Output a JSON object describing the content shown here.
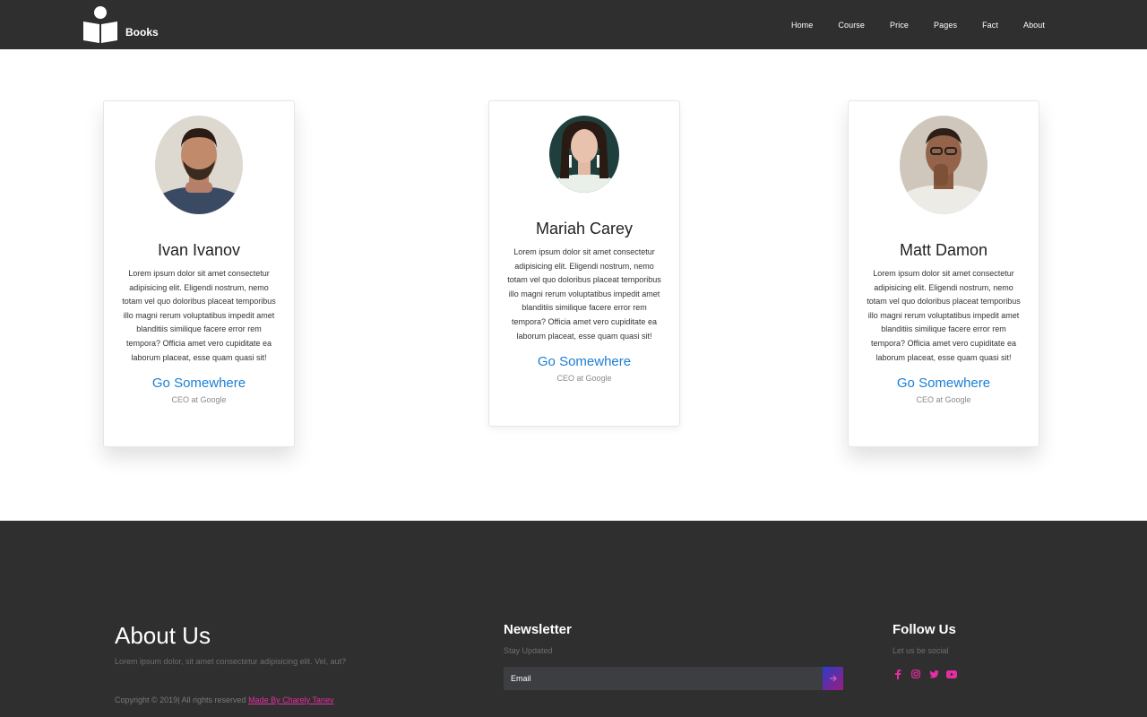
{
  "nav": {
    "brand": "Books",
    "links": [
      "Home",
      "Course",
      "Price",
      "Pages",
      "Fact",
      "About"
    ]
  },
  "cards": [
    {
      "name": "Ivan Ivanov",
      "text": "Lorem ipsum dolor sit amet consectetur adipisicing elit. Eligendi nostrum, nemo totam vel quo doloribus placeat temporibus illo magni rerum voluptatibus impedit amet blanditiis similique facere error rem tempora? Officia amet vero cupiditate ea laborum placeat, esse quam quasi sit!",
      "link": "Go Somewhere",
      "role": "CEO at Google"
    },
    {
      "name": "Mariah Carey",
      "text": "Lorem ipsum dolor sit amet consectetur adipisicing elit. Eligendi nostrum, nemo totam vel quo doloribus placeat temporibus illo magni rerum voluptatibus impedit amet blanditiis similique facere error rem tempora? Officia amet vero cupiditate ea laborum placeat, esse quam quasi sit!",
      "link": "Go Somewhere",
      "role": "CEO at Google"
    },
    {
      "name": "Matt Damon",
      "text": "Lorem ipsum dolor sit amet consectetur adipisicing elit. Eligendi nostrum, nemo totam vel quo doloribus placeat temporibus illo magni rerum voluptatibus impedit amet blanditiis similique facere error rem tempora? Officia amet vero cupiditate ea laborum placeat, esse quam quasi sit!",
      "link": "Go Somewhere",
      "role": "CEO at Google"
    }
  ],
  "footer": {
    "about_title": "About Us",
    "about_text": "Lorem ipsum dolor, sit amet consectetur adipisicing elit. Vel, aut?",
    "copyright": "Copyright © 2019| All rights reserved",
    "made_by": "Made By Charely Tanev",
    "newsletter_title": "Newsletter",
    "newsletter_sub": "Stay Updated",
    "email_placeholder": "Email",
    "follow_title": "Follow Us",
    "follow_sub": "Let us be social",
    "social_icons": [
      "facebook-icon",
      "instagram-icon",
      "twitter-icon",
      "youtube-icon"
    ],
    "social_color": "#e62ea2"
  },
  "colors": {
    "nav_bg": "#2f2f2f",
    "footer_bg": "#2f2f2f",
    "link_blue": "#1a7fd4",
    "accent_pink": "#e62ea2"
  }
}
